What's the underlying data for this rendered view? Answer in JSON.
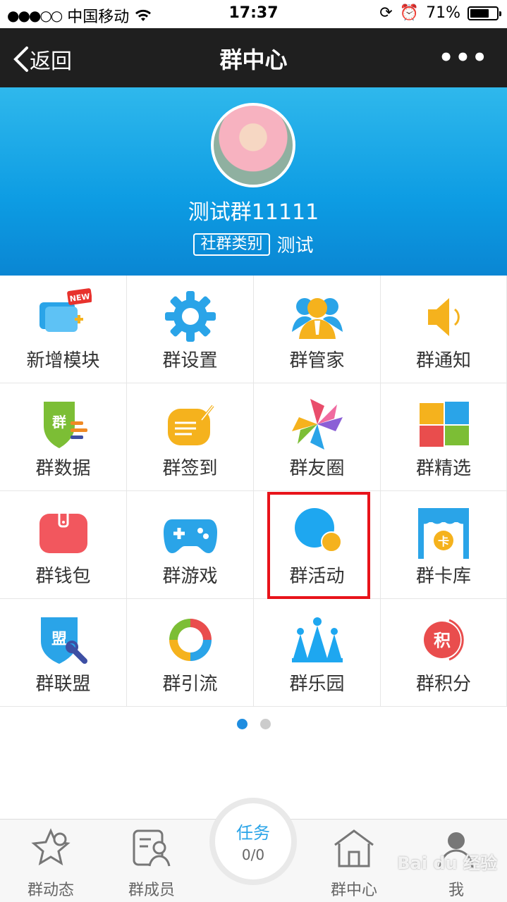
{
  "status_bar": {
    "carrier": "中国移动",
    "signal": "●●●○○",
    "time": "17:37",
    "battery": "71%"
  },
  "nav": {
    "back_label": "返回",
    "title": "群中心",
    "more": "•••"
  },
  "group": {
    "name": "测试群11111",
    "category_label": "社群类别",
    "category_value": "测试"
  },
  "grid": [
    {
      "label": "新增模块",
      "icon": "new-module-icon",
      "badge": "NEW"
    },
    {
      "label": "群设置",
      "icon": "gear-icon"
    },
    {
      "label": "群管家",
      "icon": "manager-icon"
    },
    {
      "label": "群通知",
      "icon": "speaker-icon"
    },
    {
      "label": "群数据",
      "icon": "data-shield-icon",
      "icon_text": "群"
    },
    {
      "label": "群签到",
      "icon": "signin-icon"
    },
    {
      "label": "群友圈",
      "icon": "pinwheel-icon"
    },
    {
      "label": "群精选",
      "icon": "windows-icon"
    },
    {
      "label": "群钱包",
      "icon": "wallet-icon"
    },
    {
      "label": "群游戏",
      "icon": "gamepad-icon"
    },
    {
      "label": "群活动",
      "icon": "activity-icon"
    },
    {
      "label": "群卡库",
      "icon": "card-store-icon",
      "icon_text": "卡"
    },
    {
      "label": "群联盟",
      "icon": "alliance-icon",
      "icon_text": "盟"
    },
    {
      "label": "群引流",
      "icon": "ring-icon"
    },
    {
      "label": "群乐园",
      "icon": "crown-icon"
    },
    {
      "label": "群积分",
      "icon": "points-icon",
      "icon_text": "积"
    }
  ],
  "pager": {
    "current": 1,
    "total": 2
  },
  "tabbar": {
    "items": [
      {
        "label": "群动态",
        "icon": "star-person-icon"
      },
      {
        "label": "群成员",
        "icon": "members-icon"
      },
      {
        "label": "群中心",
        "icon": "home-icon"
      },
      {
        "label": "我",
        "icon": "me-icon"
      }
    ],
    "task_label": "任务",
    "task_value": "0/0"
  },
  "watermark": "Bai du 经验",
  "colors": {
    "nav_bg": "#1f1f1f",
    "hero": "#0d9ce3",
    "accent": "#1e8de0",
    "highlight": "#e8131a"
  }
}
